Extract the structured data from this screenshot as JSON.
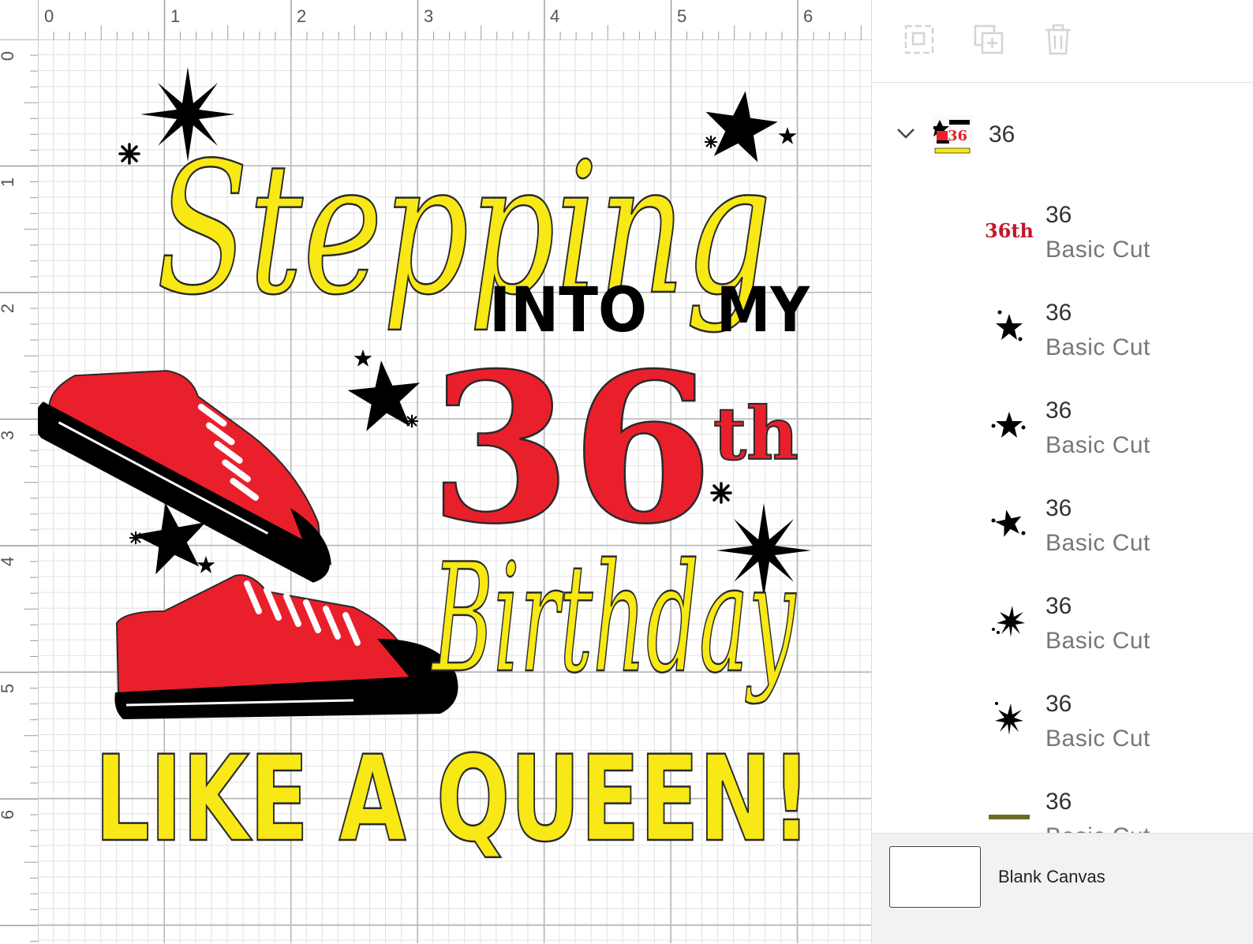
{
  "rulers": {
    "horizontal": [
      "0",
      "1",
      "2",
      "3",
      "4",
      "5",
      "6"
    ],
    "vertical": [
      "0",
      "1",
      "2",
      "3",
      "4",
      "5",
      "6"
    ]
  },
  "artwork": {
    "line1": "Stepping",
    "line2a": "INTO",
    "line2b": "MY",
    "line3": "36",
    "line3_suffix": "th",
    "line4": "Birthday",
    "line5": "LIKE A QUEEN!",
    "colors": {
      "yellow": "#f7e816",
      "red": "#ea1f2c",
      "black": "#000000",
      "outline": "#2a2a2a"
    }
  },
  "toolbar": {
    "icons": [
      "group-icon",
      "duplicate-icon",
      "delete-icon"
    ]
  },
  "layers": {
    "group": {
      "name": "36",
      "icon": "chevron-down-icon"
    },
    "items": [
      {
        "name": "36",
        "type": "Basic Cut",
        "thumb": "36th-text-thumb"
      },
      {
        "name": "36",
        "type": "Basic Cut",
        "thumb": "star-cluster-thumb"
      },
      {
        "name": "36",
        "type": "Basic Cut",
        "thumb": "star-cluster-thumb"
      },
      {
        "name": "36",
        "type": "Basic Cut",
        "thumb": "star-cluster-thumb"
      },
      {
        "name": "36",
        "type": "Basic Cut",
        "thumb": "sparkle-thumb"
      },
      {
        "name": "36",
        "type": "Basic Cut",
        "thumb": "sparkle-thumb"
      },
      {
        "name": "36",
        "type": "Basic Cut",
        "thumb": "like-a-queen-text-thumb"
      }
    ],
    "thumb_text": {
      "group": "36",
      "first": "36th"
    }
  },
  "canvas_footer": {
    "label": "Blank Canvas"
  }
}
